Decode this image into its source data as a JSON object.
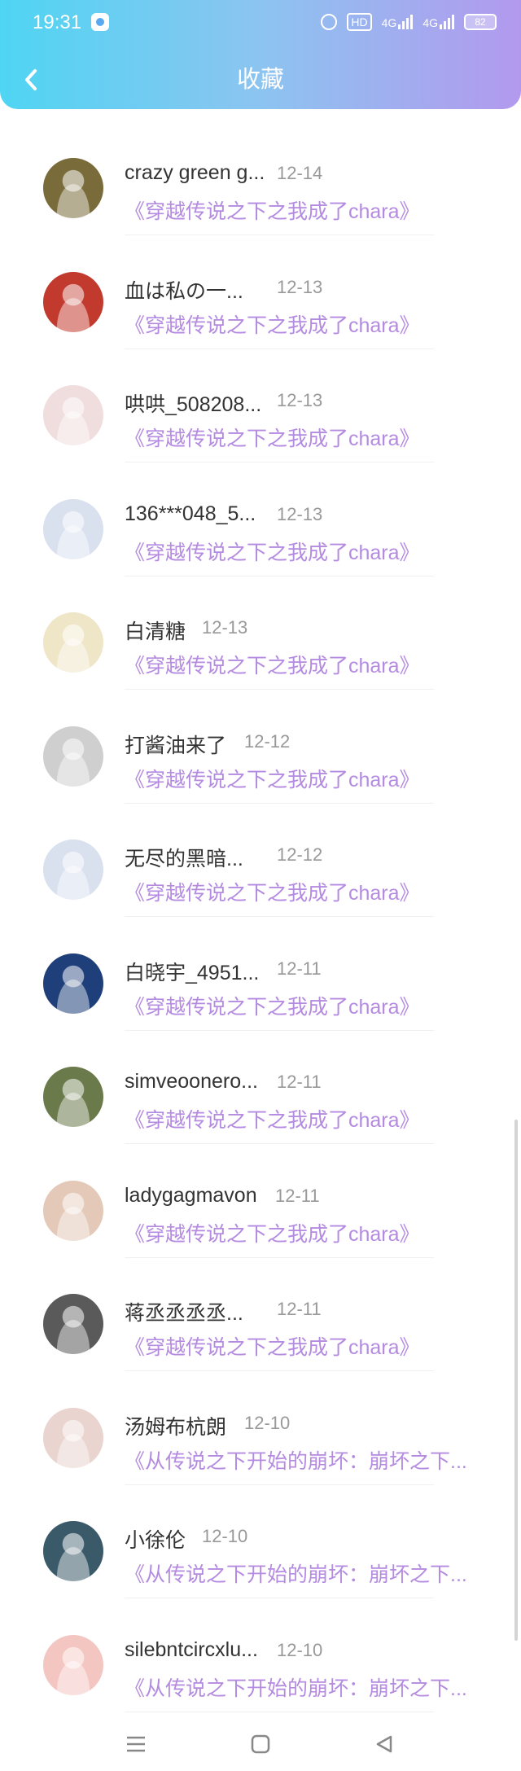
{
  "status_bar": {
    "time": "19:31",
    "hd": "HD",
    "signal1": "4G",
    "signal2": "4G",
    "battery": "82"
  },
  "header": {
    "title": "收藏"
  },
  "items": [
    {
      "name": "crazy green g...",
      "date": "12-14",
      "book": "《穿越传说之下之我成了chara》",
      "avatar_color": "#7a6b3a"
    },
    {
      "name": "血は私の一...",
      "date": "12-13",
      "book": "《穿越传说之下之我成了chara》",
      "avatar_color": "#c23a2e"
    },
    {
      "name": "哄哄_508208...",
      "date": "12-13",
      "book": "《穿越传说之下之我成了chara》",
      "avatar_color": "#f0dede"
    },
    {
      "name": "136***048_5...",
      "date": "12-13",
      "book": "《穿越传说之下之我成了chara》",
      "avatar_color": "#d9e0ee"
    },
    {
      "name": "白清糖",
      "date": "12-13",
      "book": "《穿越传说之下之我成了chara》",
      "avatar_color": "#efe6c8"
    },
    {
      "name": "打酱油来了",
      "date": "12-12",
      "book": "《穿越传说之下之我成了chara》",
      "avatar_color": "#cfcfcf"
    },
    {
      "name": "无尽的黑暗...",
      "date": "12-12",
      "book": "《穿越传说之下之我成了chara》",
      "avatar_color": "#d9e0ee"
    },
    {
      "name": "白晓宇_4951...",
      "date": "12-11",
      "book": "《穿越传说之下之我成了chara》",
      "avatar_color": "#1f3f7a"
    },
    {
      "name": "simveoonero...",
      "date": "12-11",
      "book": "《穿越传说之下之我成了chara》",
      "avatar_color": "#6a7a4a"
    },
    {
      "name": "ladygagmavon",
      "date": "12-11",
      "book": "《穿越传说之下之我成了chara》",
      "avatar_color": "#e4c9b8"
    },
    {
      "name": "蒋丞丞丞丞...",
      "date": "12-11",
      "book": "《穿越传说之下之我成了chara》",
      "avatar_color": "#5a5a5a"
    },
    {
      "name": "汤姆布杭朗",
      "date": "12-10",
      "book": "《从传说之下开始的崩坏：崩坏之下...",
      "avatar_color": "#e9d4cf"
    },
    {
      "name": "小徐伦",
      "date": "12-10",
      "book": "《从传说之下开始的崩坏：崩坏之下...",
      "avatar_color": "#3a5a6a"
    },
    {
      "name": "silebntcircxlu...",
      "date": "12-10",
      "book": "《从传说之下开始的崩坏：崩坏之下...",
      "avatar_color": "#f4c6c2"
    }
  ],
  "colors": {
    "accent": "#b48be0",
    "header_start": "#4fd5f3",
    "header_end": "#b399ee"
  }
}
